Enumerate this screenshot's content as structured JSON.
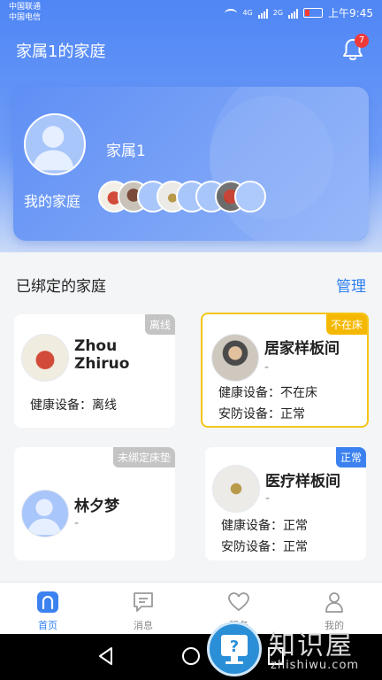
{
  "status": {
    "carrier1": "中国联通",
    "carrier2": "中国电信",
    "net1": "4G",
    "net2": "2G",
    "time": "上午9:45"
  },
  "header": {
    "title": "家属1的家庭",
    "notification_count": "7"
  },
  "profile": {
    "name": "家属1",
    "family_label": "我的家庭",
    "member_count": 7
  },
  "families": {
    "title": "已绑定的家庭",
    "manage_label": "管理",
    "cards": [
      {
        "name": "Zhou Zhiruo",
        "sub": "-",
        "tag": "离线",
        "tag_color": "#c4c4c4",
        "line1": "健康设备：离线",
        "line2": ""
      },
      {
        "name": "居家样板间",
        "sub": "-",
        "tag": "不在床",
        "tag_color": "#f5b800",
        "line1": "健康设备：不在床",
        "line2": "安防设备：正常"
      },
      {
        "name": "林夕梦",
        "sub": "-",
        "tag": "未绑定床垫",
        "tag_color": "#c4c4c4",
        "line1": "",
        "line2": ""
      },
      {
        "name": "医疗样板间",
        "sub": "-",
        "tag": "正常",
        "tag_color": "#3b82f0",
        "line1": "健康设备：正常",
        "line2": "安防设备：正常"
      }
    ]
  },
  "nav": {
    "items": [
      {
        "label": "首页",
        "icon": "home-icon"
      },
      {
        "label": "消息",
        "icon": "message-icon"
      },
      {
        "label": "服务",
        "icon": "heart-icon"
      },
      {
        "label": "我的",
        "icon": "person-icon"
      }
    ]
  },
  "watermark": {
    "text": "知识屋",
    "url": "zhishiwu.com"
  },
  "colors": {
    "accent": "#2d7ff0",
    "header": "#4f86f5"
  }
}
